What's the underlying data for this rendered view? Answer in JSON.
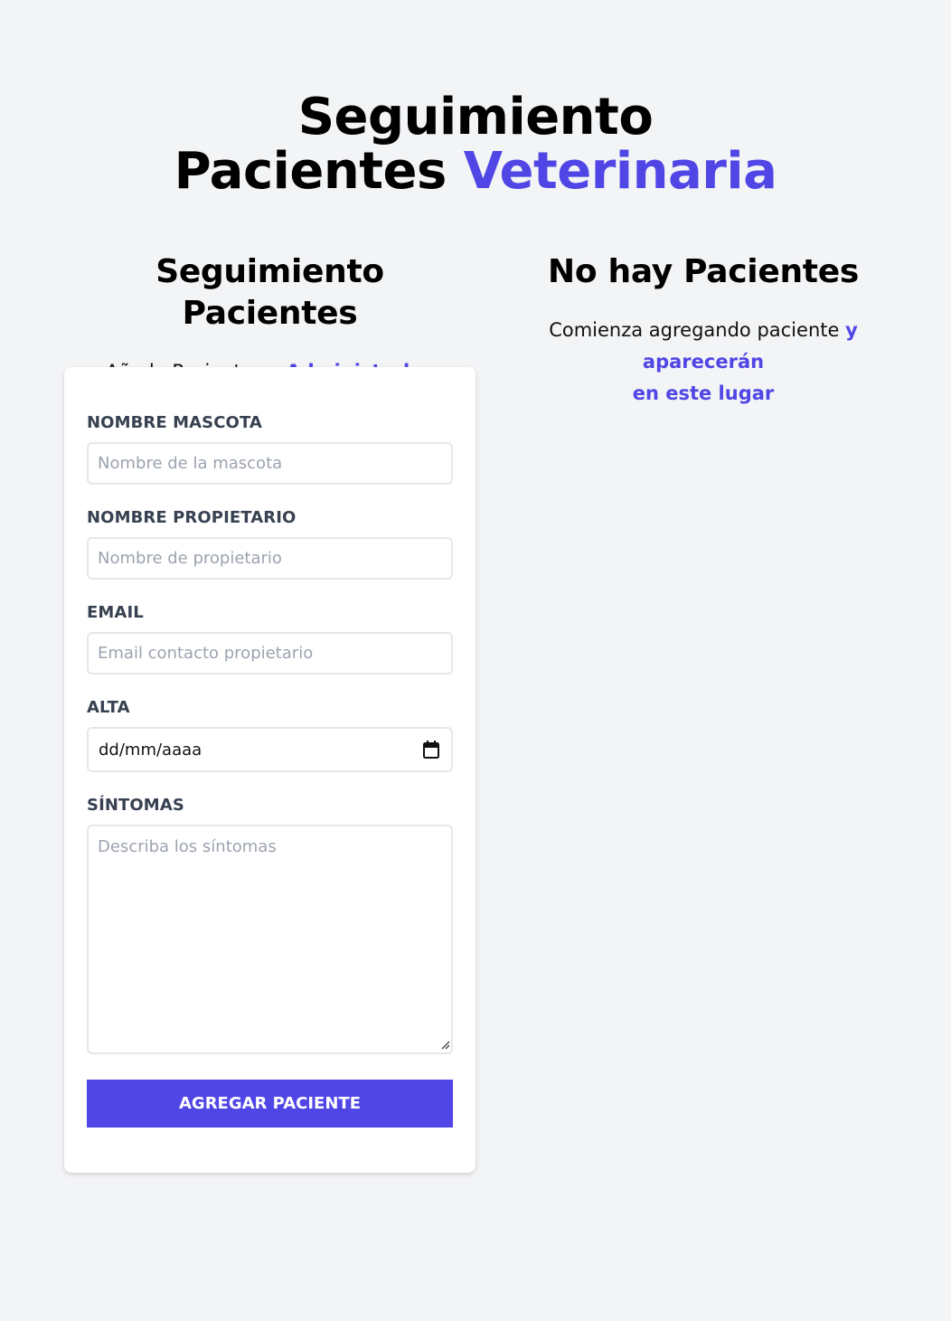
{
  "header": {
    "title_line1": "Seguimiento",
    "title_line2_plain": "Pacientes",
    "title_line2_accent": "Veterinaria"
  },
  "form_section": {
    "title": "Seguimiento Pacientes",
    "subtitle_plain": "Añade Pacientes y",
    "subtitle_accent": "Administralos"
  },
  "list_section": {
    "title": "No hay Pacientes",
    "subtitle_plain": "Comienza agregando paciente",
    "subtitle_accent_line1": "y aparecerán",
    "subtitle_accent_line2": "en este lugar"
  },
  "form": {
    "pet_name": {
      "label": "NOMBRE MASCOTA",
      "placeholder": "Nombre de la mascota",
      "value": ""
    },
    "owner_name": {
      "label": "NOMBRE PROPIETARIO",
      "placeholder": "Nombre de propietario",
      "value": ""
    },
    "email": {
      "label": "EMAIL",
      "placeholder": "Email contacto propietario",
      "value": ""
    },
    "discharge": {
      "label": "ALTA",
      "value": "dd/mm/aaaa",
      "icon": "calendar-icon"
    },
    "symptoms": {
      "label": "SÍNTOMAS",
      "placeholder": "Describa los síntomas",
      "value": ""
    },
    "submit_label": "AGREGAR PACIENTE"
  },
  "colors": {
    "accent": "#4f46e5",
    "background": "#f3f4f6",
    "card": "#ffffff",
    "label": "#374151",
    "placeholder": "#9ca3af"
  }
}
